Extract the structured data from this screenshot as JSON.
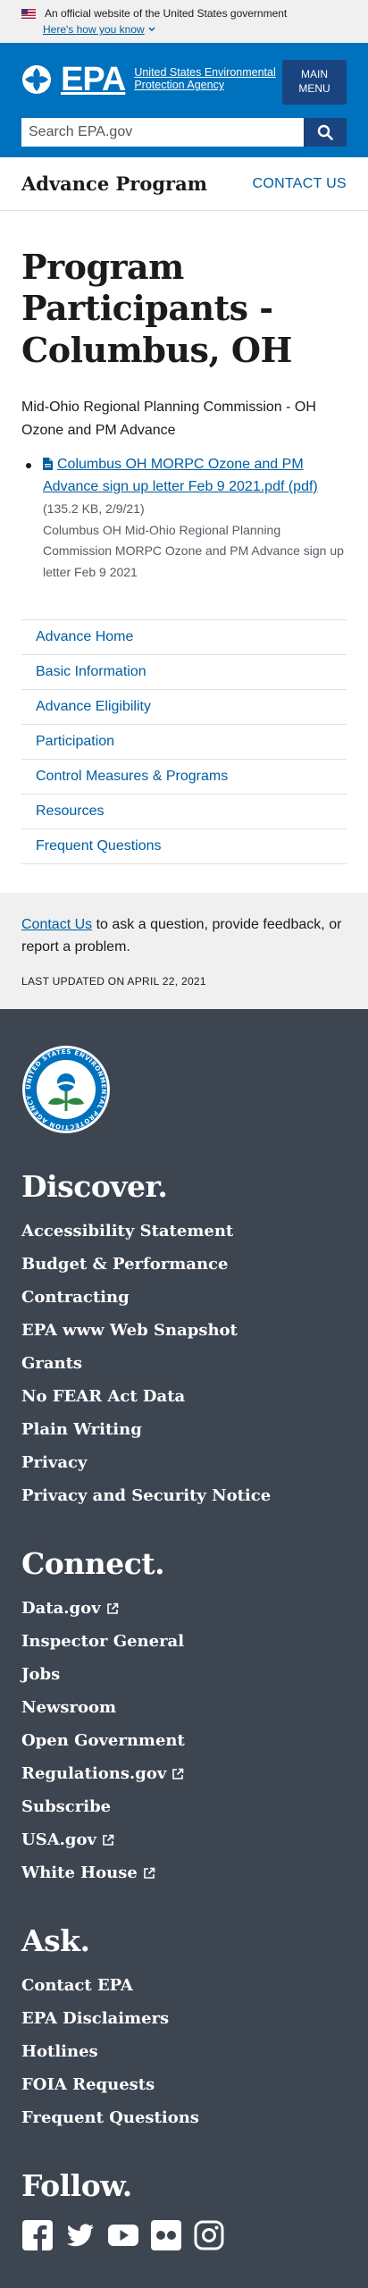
{
  "gov_banner": {
    "text": "An official website of the United States government",
    "how_link": "Here's how you know"
  },
  "header": {
    "logo_text": "EPA",
    "agency_name": "United States Environmental Protection Agency",
    "menu_line1": "MAIN",
    "menu_line2": "MENU",
    "search_placeholder": "Search EPA.gov"
  },
  "program_bar": {
    "name": "Advance Program",
    "contact": "CONTACT US"
  },
  "main": {
    "title": "Program Participants - Columbus, OH",
    "intro": "Mid-Ohio Regional Planning Commission - OH Ozone and PM Advance",
    "document": {
      "link": "Columbus OH MORPC Ozone and PM Advance sign up letter Feb 9 2021.pdf (pdf)",
      "meta": "(135.2 KB, 2/9/21)",
      "description": "Columbus OH Mid-Ohio Regional Planning Commission MORPC Ozone and PM Advance sign up letter Feb 9 2021"
    }
  },
  "sidenav": [
    {
      "label": "Advance Home"
    },
    {
      "label": "Basic Information"
    },
    {
      "label": "Advance Eligibility"
    },
    {
      "label": "Participation"
    },
    {
      "label": "Control Measures & Programs"
    },
    {
      "label": "Resources"
    },
    {
      "label": "Frequent Questions"
    }
  ],
  "contact_box": {
    "link": "Contact Us",
    "text": " to ask a question, provide feedback, or report a problem.",
    "updated": "LAST UPDATED ON APRIL 22, 2021"
  },
  "footer": {
    "seal_text": "UNITED STATES ENVIRONMENTAL PROTECTION AGENCY",
    "discover": {
      "title": "Discover.",
      "links": [
        {
          "label": "Accessibility Statement"
        },
        {
          "label": "Budget & Performance"
        },
        {
          "label": "Contracting"
        },
        {
          "label": "EPA www Web Snapshot"
        },
        {
          "label": "Grants"
        },
        {
          "label": "No FEAR Act Data"
        },
        {
          "label": "Plain Writing"
        },
        {
          "label": "Privacy"
        },
        {
          "label": "Privacy and Security Notice"
        }
      ]
    },
    "connect": {
      "title": "Connect.",
      "links": [
        {
          "label": "Data.gov",
          "external": true
        },
        {
          "label": "Inspector General"
        },
        {
          "label": "Jobs"
        },
        {
          "label": "Newsroom"
        },
        {
          "label": "Open Government"
        },
        {
          "label": "Regulations.gov",
          "external": true
        },
        {
          "label": "Subscribe"
        },
        {
          "label": "USA.gov",
          "external": true
        },
        {
          "label": "White House",
          "external": true
        }
      ]
    },
    "ask": {
      "title": "Ask.",
      "links": [
        {
          "label": "Contact EPA"
        },
        {
          "label": "EPA Disclaimers"
        },
        {
          "label": "Hotlines"
        },
        {
          "label": "FOIA Requests"
        },
        {
          "label": "Frequent Questions"
        }
      ]
    },
    "follow": {
      "title": "Follow.",
      "icons": [
        "facebook-icon",
        "twitter-icon",
        "youtube-icon",
        "flickr-icon",
        "instagram-icon"
      ]
    }
  },
  "colors": {
    "header_blue": "#0071bc",
    "dark_blue": "#1a4480",
    "link_blue": "#005ea2",
    "footer_bg": "#3d4551",
    "banner_bg": "#f0f0f0"
  }
}
